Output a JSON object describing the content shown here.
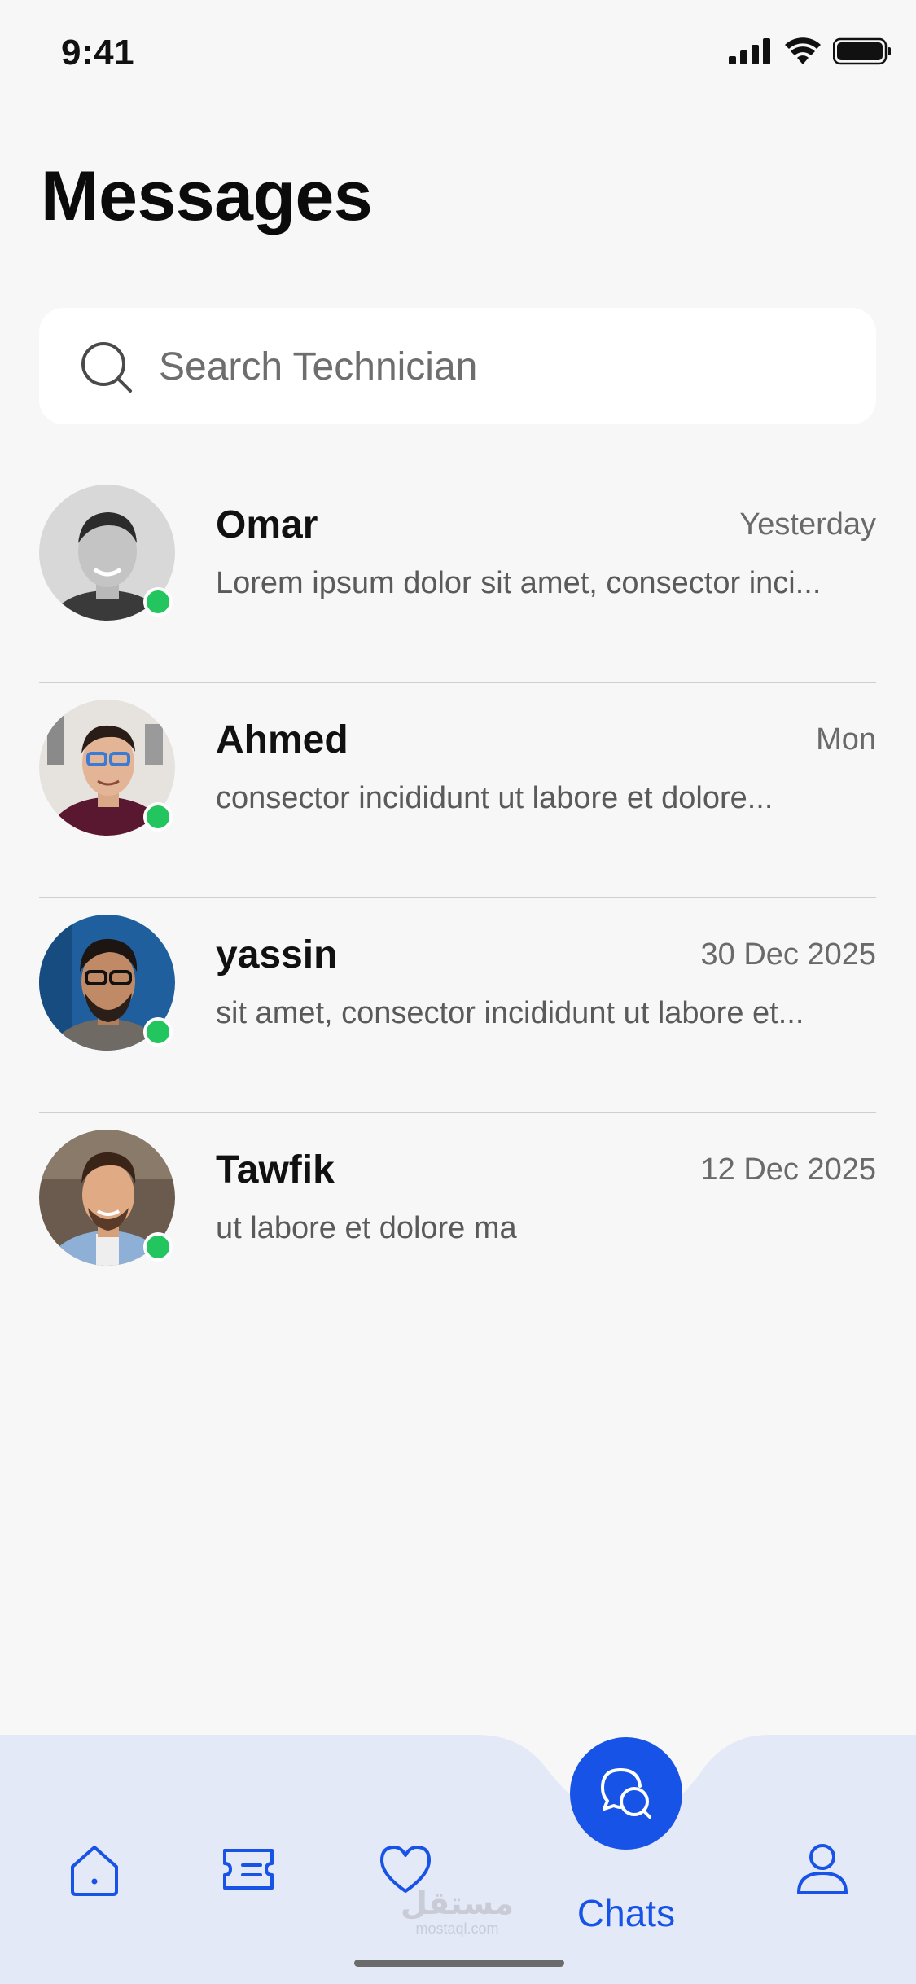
{
  "status_bar": {
    "time": "9:41"
  },
  "header": {
    "title": "Messages"
  },
  "search": {
    "placeholder": "Search Technician"
  },
  "chats": [
    {
      "name": "Omar",
      "time": "Yesterday",
      "preview": "Lorem ipsum dolor sit amet, consector inci...",
      "online": true
    },
    {
      "name": "Ahmed",
      "time": "Mon",
      "preview": " consector incididunt ut labore et dolore...",
      "online": true
    },
    {
      "name": "yassin",
      "time": "30 Dec 2025",
      "preview": " sit amet, consector incididunt ut labore et...",
      "online": true
    },
    {
      "name": "Tawfik",
      "time": "12 Dec 2025",
      "preview": " ut labore et dolore ma",
      "online": true
    }
  ],
  "bottom_nav": {
    "items": [
      {
        "icon": "home-icon"
      },
      {
        "icon": "ticket-icon"
      },
      {
        "icon": "heart-icon"
      },
      {
        "icon": "chats-icon",
        "label": "Chats",
        "active": true
      },
      {
        "icon": "user-icon"
      }
    ],
    "active_label": "Chats"
  },
  "watermark": {
    "arabic": "مستقل",
    "latin": "mostaql.com"
  },
  "colors": {
    "accent": "#1753e6",
    "online": "#22c55e",
    "nav_background": "#e4e9f7",
    "page_background": "#f7f7f7"
  }
}
